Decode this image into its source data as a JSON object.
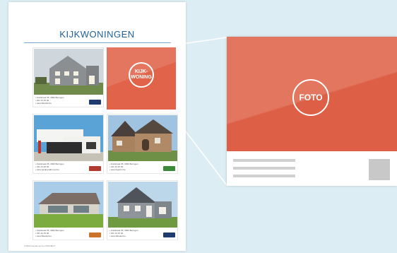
{
  "page": {
    "title": "KIJKWONINGEN",
    "footer": "6   MIJN Gevels op hun PROJECT"
  },
  "cards": [
    {
      "caption": "• Zuidstraat 95, 3990 Beringen\n• 011 23 45 00\n• www.fidanlar.be",
      "logo_color": "#1e3a6e"
    },
    {
      "caption": "• Zuidstraat 95, 3990 Beringen\n• 011 23 45 00\n• www.jacqleysabmuyt.be",
      "logo_color": "#b03a2e"
    },
    {
      "caption": "• Zuidstraat 95, 3990 Beringen\n• 011 23 45 00\n• www.bgwoni.be",
      "logo_color": "#3a8a3a"
    },
    {
      "caption": "• Zuidstraat 95, 3990 Beringen\n• 011 23 45 00\n• www.fidanlar.be",
      "logo_color": "#c9742a"
    },
    {
      "caption": "• Zuidstraat 95, 3990 Beringen\n• 011 23 45 00\n• www.fidanlar.be",
      "logo_color": "#1e3a6e"
    }
  ],
  "placeholder_small": {
    "line1": "KIJK-",
    "line2": "WONING"
  },
  "placeholder_big": {
    "label": "FOTO"
  },
  "colors": {
    "accent": "#e0634a",
    "title": "#1e5f97",
    "background": "#dcedf3"
  }
}
